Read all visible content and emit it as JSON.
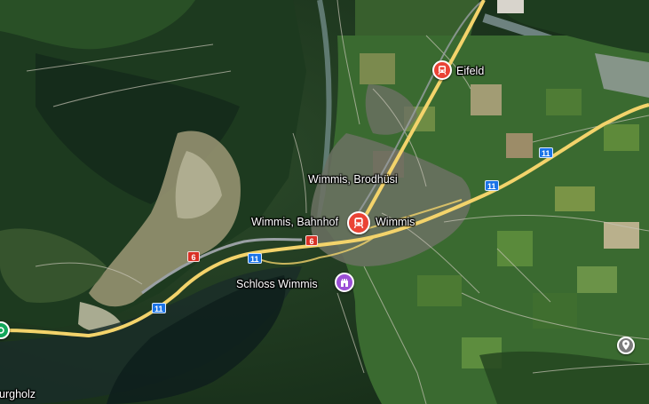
{
  "colors": {
    "rail_pin": "#ea4335",
    "castle_pin": "#9c4fd6",
    "route_shield_blue": "#1a73e8",
    "route_shield_red": "#d93025",
    "highway": "#f3d36b",
    "grey_pin": "#7b7b7b",
    "green_pin": "#11a65a"
  },
  "labels": {
    "eifeld": "Eifeld",
    "brodhuesi": "Wimmis, Brodhüsi",
    "bahnhof": "Wimmis, Bahnhof",
    "wimmis": "Wimmis",
    "schloss": "Schloss Wimmis",
    "burgholz": "urgholz"
  },
  "routes": {
    "r6_west": "6",
    "r11_bridge": "11",
    "r6_town": "6",
    "r11_south": "11",
    "r11_east": "11",
    "r11_far_east": "11"
  },
  "icons": {
    "eifeld_station": "train-icon",
    "wimmis_station": "train-icon",
    "schloss": "castle-icon",
    "east_place": "place-marker-icon",
    "west_place": "place-marker-icon"
  }
}
